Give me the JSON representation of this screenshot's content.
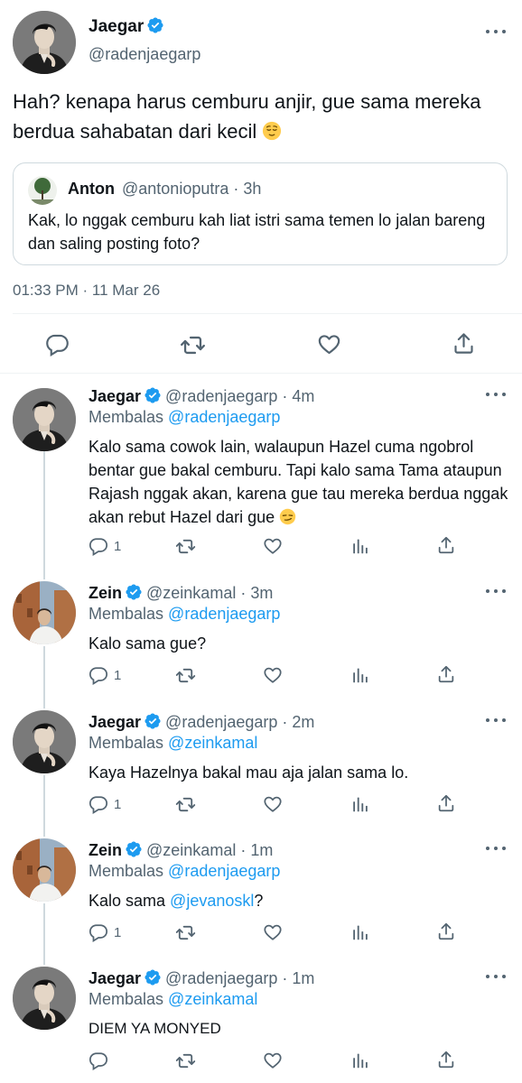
{
  "colors": {
    "accent": "#1d9bf0",
    "secondary_text": "#536471",
    "border": "#cfd9de"
  },
  "icons": [
    "reply-icon",
    "retweet-icon",
    "like-icon",
    "analytics-icon",
    "share-icon",
    "verified-badge-icon",
    "more-options-icon"
  ],
  "main_tweet": {
    "name": "Jaegar",
    "handle": "@radenjaegarp",
    "text": "Hah? kenapa harus cemburu anjir, gue sama mereka berdua sahabatan dari kecil",
    "emoji": "relieved-face",
    "timestamp": "01:33 PM · 11 Mar 26",
    "quote": {
      "name": "Anton",
      "meta": "@antonioputra · 3h",
      "text": "Kak, lo nggak cemburu kah liat istri sama temen lo jalan bareng dan saling posting foto?"
    }
  },
  "replies": [
    {
      "name": "Jaegar",
      "handle": "@radenjaegarp · 4m",
      "verified": true,
      "replying_label": "Membalas",
      "replying_to": "@radenjaegarp",
      "text": "Kalo sama cowok lain, walaupun Hazel cuma ngobrol bentar gue bakal cemburu. Tapi kalo sama Tama ataupun Rajash nggak akan, karena gue tau mereka berdua nggak akan rebut Hazel dari gue",
      "reply_count": "1"
    },
    {
      "name": "Zein",
      "handle": "@zeinkamal · 3m",
      "verified": true,
      "replying_label": "Membalas",
      "replying_to": "@radenjaegarp",
      "text": "Kalo sama gue?",
      "reply_count": "1"
    },
    {
      "name": "Jaegar",
      "handle": "@radenjaegarp · 2m",
      "verified": true,
      "replying_label": "Membalas",
      "replying_to": "@zeinkamal",
      "text": "Kaya Hazelnya bakal mau aja jalan sama lo.",
      "reply_count": "1"
    },
    {
      "name": "Zein",
      "handle": "@zeinkamal · 1m",
      "verified": true,
      "replying_label": "Membalas",
      "replying_to": "@radenjaegarp",
      "text_before": "Kalo sama ",
      "text_mention": "@jevanoskl",
      "text_after": "?",
      "reply_count": "1"
    },
    {
      "name": "Jaegar",
      "handle": "@radenjaegarp · 1m",
      "verified": true,
      "replying_label": "Membalas",
      "replying_to": "@zeinkamal",
      "text": "DIEM YA MONYED",
      "reply_count": ""
    }
  ]
}
